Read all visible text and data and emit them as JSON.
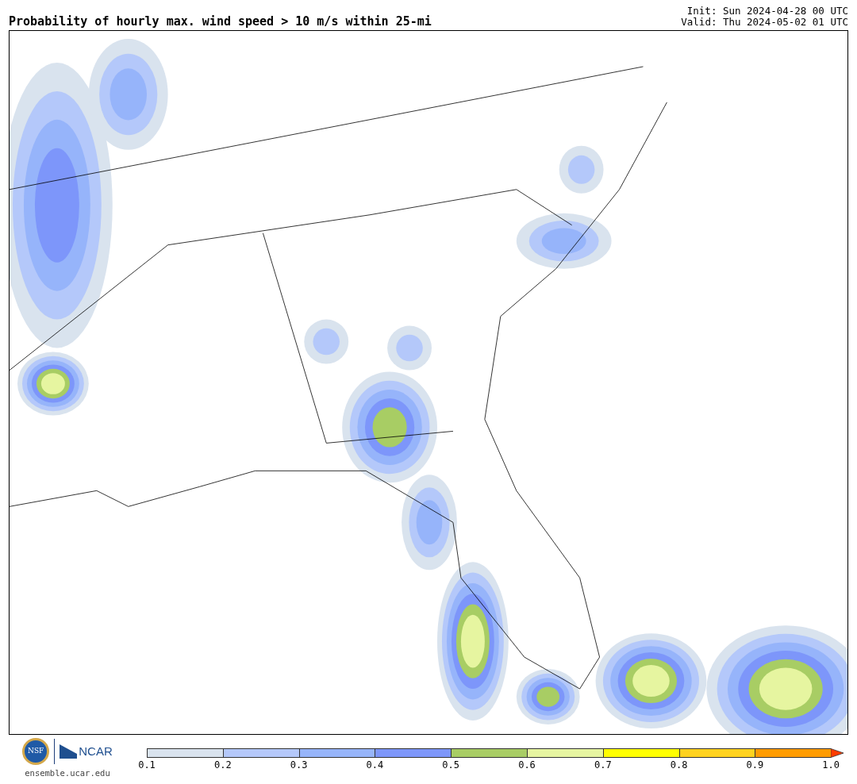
{
  "header": {
    "title": "Probability of hourly max. wind speed > 10 m/s within 25-mi",
    "init": "Init: Sun 2024-04-28 00 UTC",
    "valid": "Valid: Thu 2024-05-02 01 UTC"
  },
  "footer": {
    "logos": {
      "nsf": "NSF",
      "ncar": "NCAR"
    },
    "site": "ensemble.ucar.edu"
  },
  "colorbar": {
    "segments": [
      {
        "kind": "band",
        "color": "#d9e3ee"
      },
      {
        "kind": "band",
        "color": "#b4c8fa"
      },
      {
        "kind": "band",
        "color": "#96b4fa"
      },
      {
        "kind": "band",
        "color": "#7d96fa"
      },
      {
        "kind": "band",
        "color": "#a8cd64"
      },
      {
        "kind": "band",
        "color": "#e6f5a0"
      },
      {
        "kind": "band",
        "color": "#ffff00"
      },
      {
        "kind": "band",
        "color": "#ffd21e"
      },
      {
        "kind": "band",
        "color": "#ff9b00"
      },
      {
        "kind": "arrow",
        "color": "#ff3c00"
      }
    ],
    "ticks": [
      "0.1",
      "0.2",
      "0.3",
      "0.4",
      "0.5",
      "0.6",
      "0.7",
      "0.8",
      "0.9",
      "1.0"
    ]
  }
}
